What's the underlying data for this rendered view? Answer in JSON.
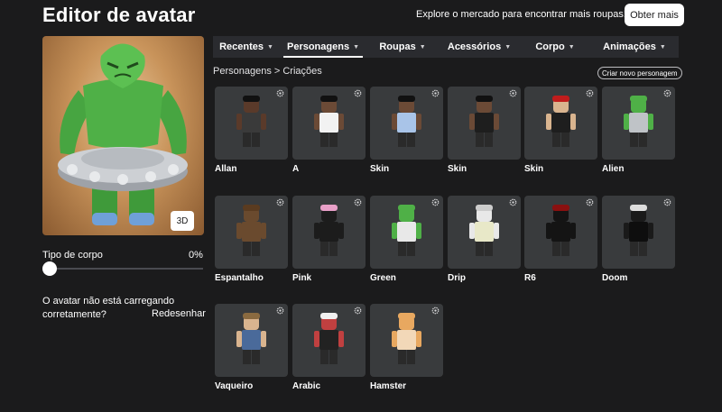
{
  "header": {
    "title": "Editor de avatar",
    "promo_text": "Explore o mercado para encontrar mais roupas!",
    "more_button": "Obter mais"
  },
  "preview": {
    "view_toggle": "3D",
    "body_type_label": "Tipo de corpo",
    "body_type_value": "0%",
    "body_type_level": 0,
    "loading_message": "O avatar não está carregando corretamente?",
    "redraw_label": "Redesenhar"
  },
  "tabs": [
    {
      "label": "Recentes",
      "active": false
    },
    {
      "label": "Personagens",
      "active": true
    },
    {
      "label": "Roupas",
      "active": false
    },
    {
      "label": "Acessórios",
      "active": false
    },
    {
      "label": "Corpo",
      "active": false
    },
    {
      "label": "Animações",
      "active": false
    }
  ],
  "breadcrumb": "Personagens > Criações",
  "create_button": "Criar novo personagem",
  "characters": [
    {
      "name": "Allan"
    },
    {
      "name": "A"
    },
    {
      "name": "Skin"
    },
    {
      "name": "Skin"
    },
    {
      "name": "Skin"
    },
    {
      "name": "Alien"
    },
    {
      "name": "Espantalho"
    },
    {
      "name": "Pink"
    },
    {
      "name": "Green"
    },
    {
      "name": "Drip"
    },
    {
      "name": "R6"
    },
    {
      "name": "Doom"
    },
    {
      "name": "Vaqueiro"
    },
    {
      "name": "Arabic"
    },
    {
      "name": "Hamster"
    }
  ],
  "colors": {
    "background": "#1b1b1c",
    "tabbar": "#2a2b2f",
    "card": "#393b3d",
    "accent": "#ffffff"
  }
}
